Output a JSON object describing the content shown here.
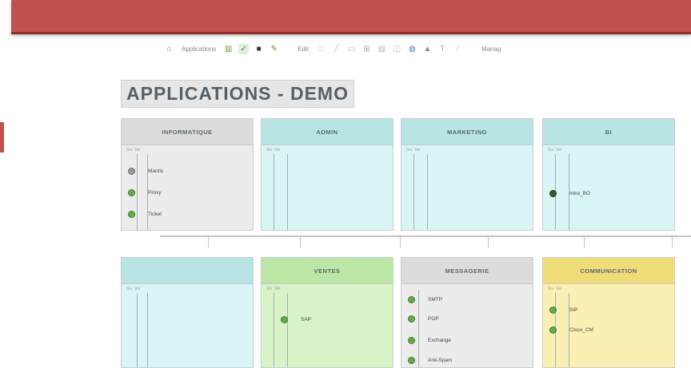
{
  "toolbar": {
    "applications_label": "Applications",
    "edit_label": "Edit",
    "manage_label": "Manag"
  },
  "page_title": "APPLICATIONS - DEMO",
  "column_labels": [
    "Srv",
    "Ver"
  ],
  "colors": {
    "topbar": "#c0504d",
    "gray_box": "#ececec",
    "cyan_box": "#d9f5f5",
    "green_box": "#d8f3c7",
    "yellow_box": "#fbf0b3",
    "status_ok": "#5fae4a"
  },
  "boxes": [
    {
      "id": "informatique",
      "title": "INFORMATIQUE",
      "items": [
        "Mantis",
        "Proxy",
        "Ticket"
      ]
    },
    {
      "id": "admin",
      "title": "ADMIN",
      "items": []
    },
    {
      "id": "marketing",
      "title": "MARKETING",
      "items": []
    },
    {
      "id": "bi",
      "title": "BI",
      "items": [
        "Intra_BO"
      ]
    },
    {
      "id": "unnamed",
      "title": "",
      "items": []
    },
    {
      "id": "ventes",
      "title": "VENTES",
      "items": [
        "SAP"
      ]
    },
    {
      "id": "messagerie",
      "title": "MESSAGERIE",
      "items": [
        "SMTP",
        "POP",
        "Exchange",
        "Anti-Spam"
      ]
    },
    {
      "id": "communication",
      "title": "COMMUNICATION",
      "items": [
        "SIP",
        "Cisco_CM"
      ]
    }
  ]
}
